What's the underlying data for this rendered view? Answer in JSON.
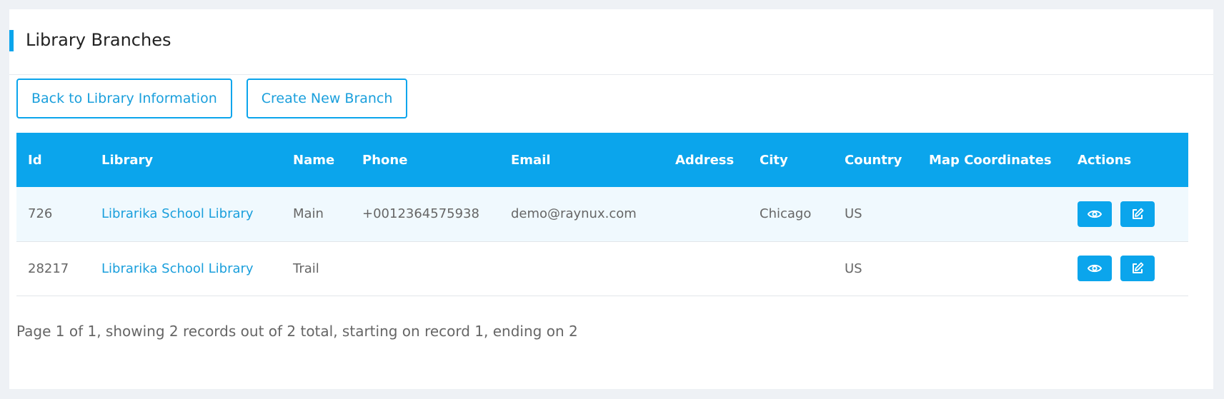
{
  "header": {
    "title": "Library Branches"
  },
  "toolbar": {
    "back_label": "Back to Library Information",
    "create_label": "Create New Branch"
  },
  "table": {
    "columns": [
      "Id",
      "Library",
      "Name",
      "Phone",
      "Email",
      "Address",
      "City",
      "Country",
      "Map Coordinates",
      "Actions"
    ],
    "rows": [
      {
        "id": "726",
        "library": "Librarika School Library",
        "name": "Main",
        "phone": "+0012364575938",
        "email": "demo@raynux.com",
        "address": "",
        "city": "Chicago",
        "country": "US",
        "coordinates": ""
      },
      {
        "id": "28217",
        "library": "Librarika School Library",
        "name": "Trail",
        "phone": "",
        "email": "",
        "address": "",
        "city": "",
        "country": "US",
        "coordinates": ""
      }
    ],
    "action_icons": [
      "eye-icon",
      "edit-icon"
    ]
  },
  "footer": {
    "pagination_text": "Page 1 of 1, showing 2 records out of 2 total, starting on record 1, ending on 2"
  },
  "colors": {
    "accent": "#0ba5ec",
    "link": "#1a9fdc",
    "row_stripe": "#f0f9fe",
    "background": "#eef1f5"
  }
}
